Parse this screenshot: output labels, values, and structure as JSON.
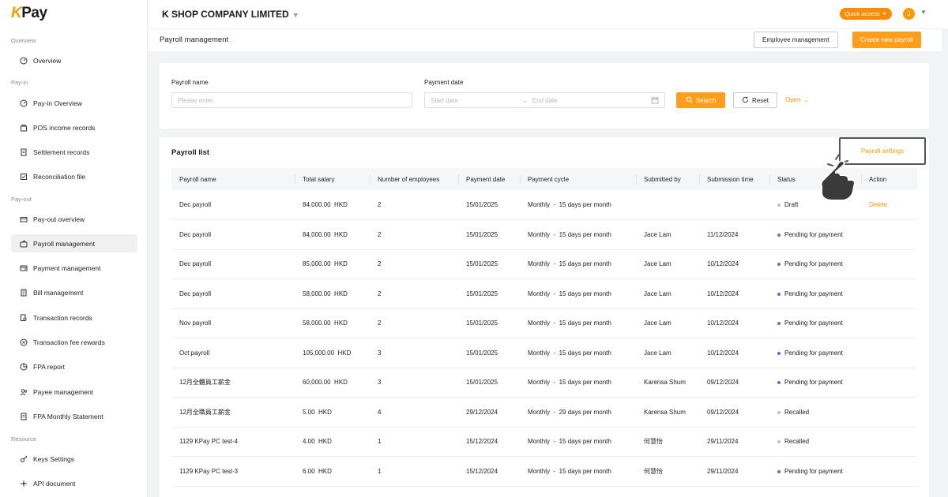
{
  "brand": {
    "logo_k": "K",
    "logo_rest": "Pay"
  },
  "header": {
    "company": "K SHOP COMPANY LIMITED",
    "quick_access": "Quick access",
    "avatar_initial": "J"
  },
  "sidebar": {
    "sections": [
      {
        "title": "Overview"
      },
      {
        "title": "Pay-in"
      },
      {
        "title": "Pay-out"
      },
      {
        "title": "Resource"
      }
    ],
    "items": [
      {
        "label": "Overview",
        "icon": "dashboard-icon"
      },
      {
        "label": "Pay-in Overview",
        "icon": "dashboard-icon"
      },
      {
        "label": "POS income records",
        "icon": "shop-icon"
      },
      {
        "label": "Settlement records",
        "icon": "document-icon"
      },
      {
        "label": "Reconciliation file",
        "icon": "file-check-icon"
      },
      {
        "label": "Pay-out overview",
        "icon": "card-icon"
      },
      {
        "label": "Payroll management",
        "icon": "wallet-icon",
        "active": true
      },
      {
        "label": "Payment management",
        "icon": "payment-icon"
      },
      {
        "label": "Bill management",
        "icon": "bill-icon"
      },
      {
        "label": "Transaction records",
        "icon": "search-doc-icon"
      },
      {
        "label": "Transaction fee rewards",
        "icon": "reward-icon"
      },
      {
        "label": "FPA report",
        "icon": "report-icon"
      },
      {
        "label": "Payee management",
        "icon": "users-icon"
      },
      {
        "label": "FPA Monthly Statement",
        "icon": "statement-icon"
      },
      {
        "label": "Keys Settings",
        "icon": "key-icon"
      },
      {
        "label": "API document",
        "icon": "api-icon"
      }
    ]
  },
  "subheader": {
    "title": "Payroll management",
    "employee_btn": "Employee management",
    "create_btn": "Create new payroll"
  },
  "filter": {
    "name_label": "Payroll name",
    "name_placeholder": "Please enter",
    "date_label": "Payment date",
    "start_placeholder": "Start date",
    "end_placeholder": "End date",
    "search_btn": "Search",
    "reset_btn": "Reset",
    "open_link": "Open"
  },
  "list": {
    "title": "Payroll list",
    "settings_link": "Payroll settings",
    "columns": [
      "Payroll name",
      "Total salary",
      "Number of employees",
      "Payment date",
      "Payment cycle",
      "Submitted by",
      "Submission time",
      "Status",
      "Action"
    ],
    "rows": [
      {
        "name": "Dec payroll",
        "salary": "84,000.00",
        "currency": "HKD",
        "employees": "2",
        "date": "15/01/2025",
        "cycle_a": "Monthly",
        "cycle_b": "15 days per month",
        "by": "",
        "time": "",
        "status": "Draft",
        "status_color": "#c0c0c0",
        "action": "Delete"
      },
      {
        "name": "Dec payroll",
        "salary": "84,000.00",
        "currency": "HKD",
        "employees": "2",
        "date": "15/01/2025",
        "cycle_a": "Monthly",
        "cycle_b": "15 days per month",
        "by": "Jace Lam",
        "time": "11/12/2024",
        "status": "Pending for payment",
        "status_color": "#6b6bd6",
        "action": ""
      },
      {
        "name": "Dec payroll",
        "salary": "85,000.00",
        "currency": "HKD",
        "employees": "2",
        "date": "15/01/2025",
        "cycle_a": "Monthly",
        "cycle_b": "15 days per month",
        "by": "Jace Lam",
        "time": "10/12/2024",
        "status": "Pending for payment",
        "status_color": "#6b6bd6",
        "action": ""
      },
      {
        "name": "Dec payroll",
        "salary": "58,000.00",
        "currency": "HKD",
        "employees": "2",
        "date": "15/01/2025",
        "cycle_a": "Monthly",
        "cycle_b": "15 days per month",
        "by": "Jace Lam",
        "time": "10/12/2024",
        "status": "Pending for payment",
        "status_color": "#6b6bd6",
        "action": ""
      },
      {
        "name": "Nov payroll",
        "salary": "58,000.00",
        "currency": "HKD",
        "employees": "2",
        "date": "15/01/2025",
        "cycle_a": "Monthly",
        "cycle_b": "15 days per month",
        "by": "Jace Lam",
        "time": "10/12/2024",
        "status": "Pending for payment",
        "status_color": "#6b6bd6",
        "action": ""
      },
      {
        "name": "Oct payroll",
        "salary": "105,000.00",
        "currency": "HKD",
        "employees": "3",
        "date": "15/01/2025",
        "cycle_a": "Monthly",
        "cycle_b": "15 days per month",
        "by": "Jace Lam",
        "time": "10/12/2024",
        "status": "Pending for payment",
        "status_color": "#6b6bd6",
        "action": ""
      },
      {
        "name": "12月全體員工薪金",
        "salary": "60,000.00",
        "currency": "HKD",
        "employees": "3",
        "date": "15/01/2025",
        "cycle_a": "Monthly",
        "cycle_b": "15 days per month",
        "by": "Karensa Shum",
        "time": "09/12/2024",
        "status": "Pending for payment",
        "status_color": "#6b6bd6",
        "action": ""
      },
      {
        "name": "12月全職員工薪金",
        "salary": "5.00",
        "currency": "HKD",
        "employees": "4",
        "date": "29/12/2024",
        "cycle_a": "Monthly",
        "cycle_b": "29 days per month",
        "by": "Karensa Shum",
        "time": "09/12/2024",
        "status": "Recalled",
        "status_color": "#c0c0c0",
        "action": ""
      },
      {
        "name": "1129 KPay PC test-4",
        "salary": "4.00",
        "currency": "HKD",
        "employees": "1",
        "date": "15/12/2024",
        "cycle_a": "Monthly",
        "cycle_b": "15 days per month",
        "by": "何慧怡",
        "time": "29/11/2024",
        "status": "Recalled",
        "status_color": "#c0c0c0",
        "action": ""
      },
      {
        "name": "1129 KPay PC test-3",
        "salary": "6.00",
        "currency": "HKD",
        "employees": "1",
        "date": "15/12/2024",
        "cycle_a": "Monthly",
        "cycle_b": "15 days per month",
        "by": "何慧怡",
        "time": "29/11/2024",
        "status": "Pending for payment",
        "status_color": "#6b6bd6",
        "action": ""
      }
    ]
  },
  "colors": {
    "accent": "#ff9e1b",
    "pending": "#6b6bd6",
    "neutral": "#c0c0c0"
  }
}
